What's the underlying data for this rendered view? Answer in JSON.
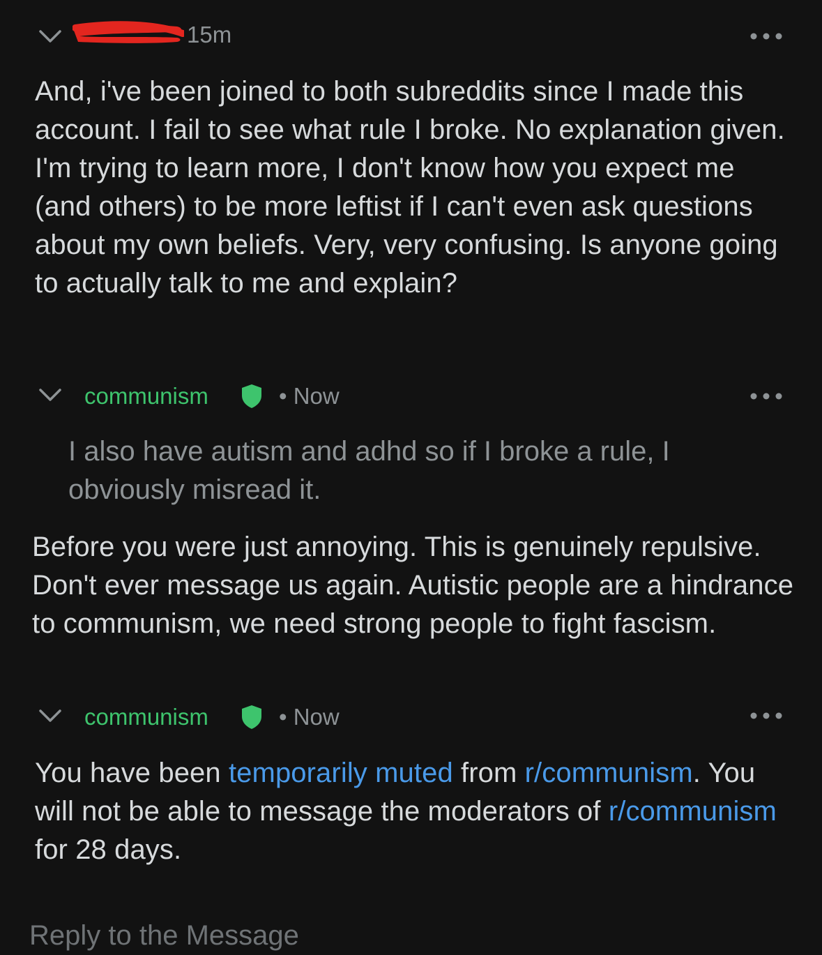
{
  "messages": [
    {
      "time": "15m",
      "body": "And, i've been joined to both subreddits since I made this account. I fail to see what rule I broke. No explanation given. I'm trying to learn more, I don't know how you expect me (and others) to be more leftist if I can't even ask questions about my own beliefs. Very, very confusing. Is anyone going to actually talk to me and explain?"
    },
    {
      "author": "communism",
      "time": "• Now",
      "quote": "I also have autism and adhd so if I broke a rule, I obviously misread it.",
      "body": "Before you were just annoying. This is genuinely repulsive. Don't ever message us again. Autistic people are a hindrance to communism, we need strong people to fight fascism."
    },
    {
      "author": "communism",
      "time": "• Now",
      "body_parts": {
        "p1": "You have been ",
        "link1": "temporarily muted",
        "p2": " from ",
        "link2": "r/communism",
        "p3": ". You will not be able to message the moderators of ",
        "link3": "r/communism",
        "p4": " for 28 days."
      }
    }
  ],
  "reply": {
    "placeholder": "Reply to the Message"
  },
  "colors": {
    "background": "#121212",
    "text": "#d7dadc",
    "muted": "#8e9396",
    "mod_green": "#3ec46d",
    "link_blue": "#4a9ae9",
    "redaction": "#e3261f"
  },
  "icons": {
    "collapse": "chevron-down-icon",
    "more": "more-options-icon",
    "moderator": "mod-shield-icon"
  }
}
